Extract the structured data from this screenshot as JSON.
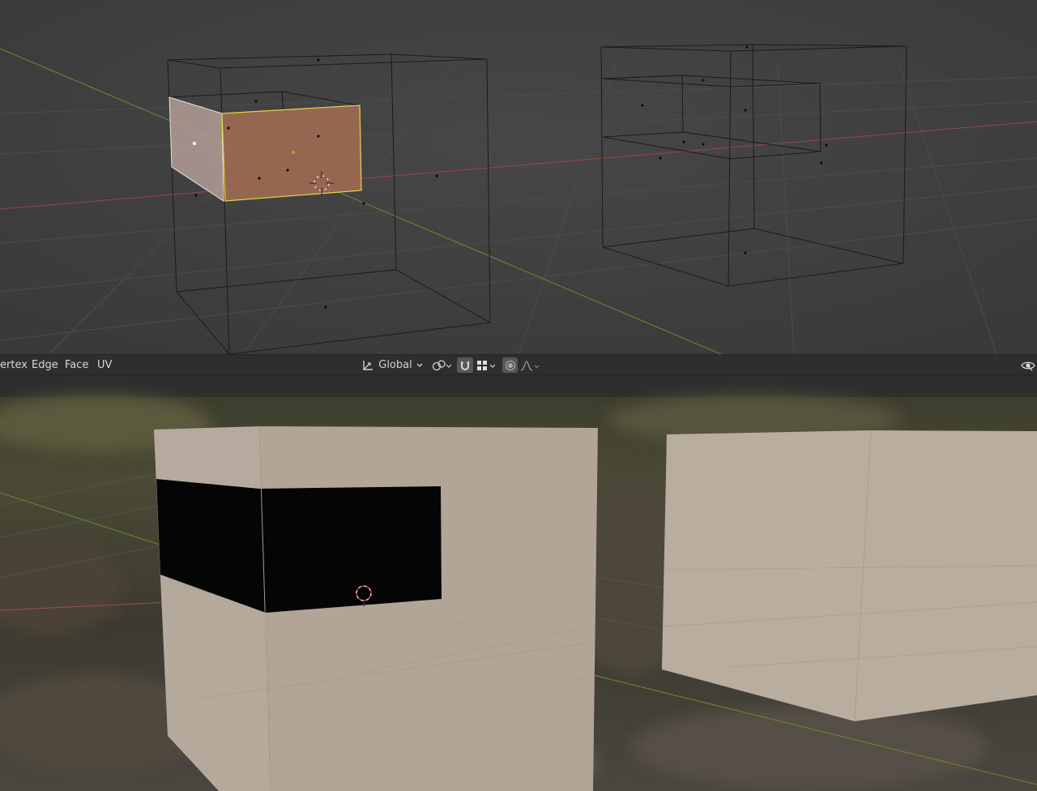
{
  "header": {
    "menus": [
      "ertex",
      "Edge",
      "Face",
      "UV"
    ],
    "orientation_label": "Global"
  },
  "icons": {
    "orientation": "transform-orientation-icon",
    "pivot": "pivot-point-icon",
    "snap": "snap-magnet-icon",
    "snap_target": "snap-increment-icon",
    "proportional": "proportional-editing-icon",
    "falloff": "falloff-curve-icon",
    "visibility": "eye-icon"
  },
  "colors": {
    "selected_face": "#a06c52",
    "selected_edge": "#e6d34a",
    "unselected_face": "#b49e97",
    "material": "#b9ada1",
    "hole": "#050505",
    "x_axis": "#a04040",
    "y_axis": "#6e8a2e"
  }
}
